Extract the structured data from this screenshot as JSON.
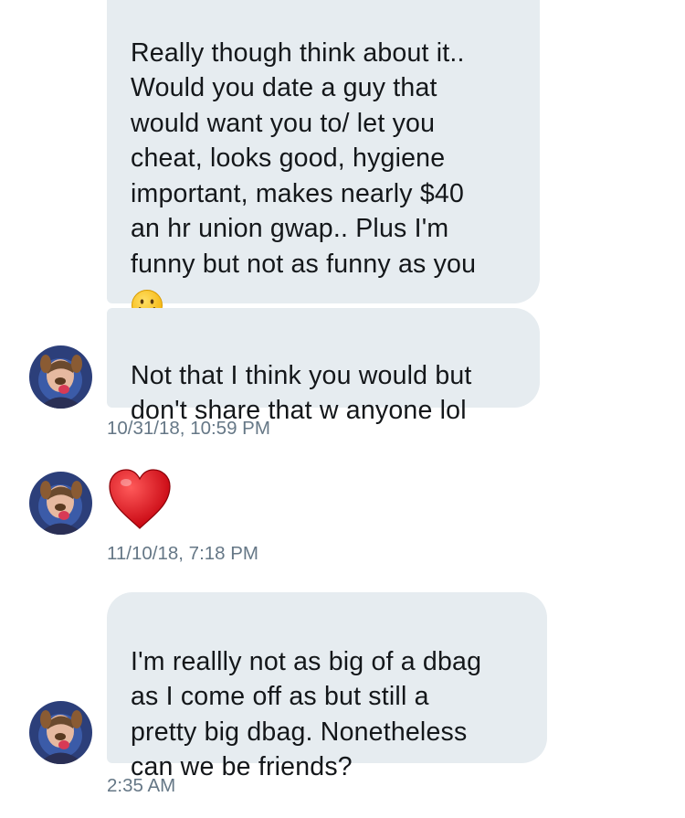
{
  "messages": [
    {
      "text": "Really though think about it..\nWould you date a guy that\nwould want you to/ let you\ncheat, looks good, hygiene\nimportant, makes nearly $40\nan hr union gwap.. Plus I'm\nfunny but not as funny as you"
    },
    {
      "text": "Not that I think you would but\ndon't share that w anyone lol"
    },
    {
      "text": "I'm reallly not as big of a dbag\nas I come off as but still a\npretty big dbag. Nonetheless\ncan we be friends?"
    }
  ],
  "timestamps": [
    "10/31/18, 10:59 PM",
    "11/10/18, 7:18 PM",
    "2:35 AM"
  ],
  "icons": {
    "smiley": "slightly-smiling-face-emoji",
    "heart": "red-heart-emoji",
    "avatar": "user-avatar-photo"
  },
  "colors": {
    "bubble": "#e6ecf0",
    "timestamp": "#657786",
    "heart": "#e0131a"
  }
}
